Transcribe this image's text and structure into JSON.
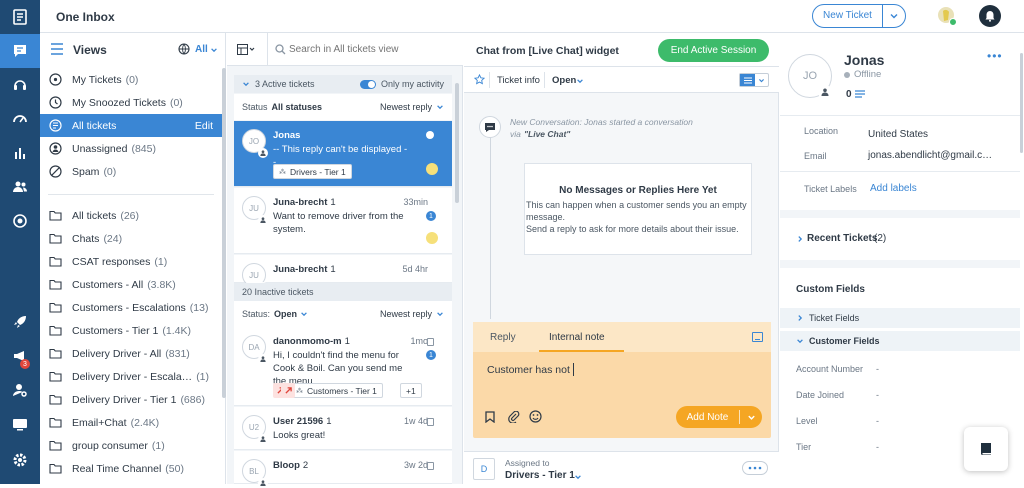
{
  "app": {
    "title": "One Inbox",
    "new_ticket_label": "New Ticket"
  },
  "rail": {
    "items": [
      "articles-icon",
      "inbox-icon",
      "headset-icon",
      "dashboard-icon",
      "reports-icon",
      "contacts-icon",
      "target-icon",
      "rocket-icon",
      "announcements-icon",
      "user-settings-icon",
      "monitor-icon",
      "settings-icon"
    ],
    "announcement_badge": "3"
  },
  "views": {
    "title": "Views",
    "filter_label": "All",
    "edit_label": "Edit",
    "items": [
      {
        "label": "My Tickets",
        "count": "(0)",
        "icon": "my-tickets-icon"
      },
      {
        "label": "My Snoozed Tickets",
        "count": "(0)",
        "icon": "clock-icon"
      },
      {
        "label": "All tickets",
        "count": "",
        "icon": "all-tickets-icon"
      },
      {
        "label": "Unassigned",
        "count": "(845)",
        "icon": "unassigned-icon"
      },
      {
        "label": "Spam",
        "count": "(0)",
        "icon": "spam-icon"
      }
    ],
    "folders": [
      {
        "label": "All tickets",
        "count": "(26)"
      },
      {
        "label": "Chats",
        "count": "(24)"
      },
      {
        "label": "CSAT responses",
        "count": "(1)"
      },
      {
        "label": "Customers - All",
        "count": "(3.8K)"
      },
      {
        "label": "Customers - Escalations",
        "count": "(13)"
      },
      {
        "label": "Customers - Tier 1",
        "count": "(1.4K)"
      },
      {
        "label": "Delivery Driver - All",
        "count": "(831)"
      },
      {
        "label": "Delivery Driver - Escala…",
        "count": "(1)"
      },
      {
        "label": "Delivery Driver - Tier 1",
        "count": "(686)"
      },
      {
        "label": "Email+Chat",
        "count": "(2.4K)"
      },
      {
        "label": "group consumer",
        "count": "(1)"
      },
      {
        "label": "Real Time Channel",
        "count": "(50)"
      }
    ]
  },
  "list": {
    "search_placeholder": "Search in All tickets view",
    "active_header": "3 Active tickets",
    "only_my_activity": "Only my activity",
    "status_label": "Status",
    "status_value": "All statuses",
    "sort_label": "Newest reply",
    "inactive_header": "20 Inactive tickets",
    "status2_label": "Status:",
    "status2_value": "Open",
    "active": [
      {
        "initials": "JO",
        "name": "Jonas",
        "num": "",
        "time": "",
        "snippet": "-- This reply can't be displayed --",
        "tag": "Drivers - Tier 1"
      },
      {
        "initials": "JU",
        "name": "Juna-brecht",
        "num": "1",
        "time": "33min",
        "snippet": "Want to remove driver from the system.",
        "unread": "1"
      },
      {
        "initials": "JU",
        "name": "Juna-brecht",
        "num": "1",
        "time": "5d 4hr",
        "snippet": ""
      }
    ],
    "inactive": [
      {
        "initials": "DA",
        "name": "danonmomo-m",
        "num": "1",
        "time": "1mo",
        "snippet": "Hi, I couldn't find the menu for Cook & Boil. Can you send me the menu…",
        "unread": "1",
        "tag": "Customers - Tier 1",
        "more": "+1"
      },
      {
        "initials": "U2",
        "name": "User 21596",
        "num": "1",
        "time": "1w 4d",
        "snippet": "Looks great!"
      },
      {
        "initials": "BL",
        "name": "Bloop",
        "num": "2",
        "time": "3w 2d",
        "snippet": ""
      }
    ]
  },
  "conversation": {
    "title": "Chat from [Live Chat] widget",
    "end_session": "End Active Session",
    "ticket_info": "Ticket info",
    "status": "Open",
    "event_text": "New Conversation: Jonas started a conversation",
    "event_via": "via",
    "event_channel": "\"Live Chat\"",
    "nomsg_title": "No Messages or Replies Here Yet",
    "nomsg_body1": "This can happen when a customer sends you an empty message.",
    "nomsg_body2": "Send a reply to ask for more details about their issue.",
    "reply_tab": "Reply",
    "note_tab": "Internal note",
    "draft": "Customer has not",
    "add_note": "Add Note",
    "assigned_label": "Assigned to",
    "assigned_value": "Drivers - Tier 1",
    "assigned_initial": "D"
  },
  "contact": {
    "initials": "JO",
    "name": "Jonas",
    "status": "Offline",
    "score": "0",
    "location_label": "Location",
    "location_value": "United States",
    "email_label": "Email",
    "email_value": "jonas.abendlicht@gmail.c…",
    "labels_label": "Ticket Labels",
    "add_labels": "Add labels",
    "recent_tickets": "Recent Tickets",
    "recent_count": "(2)",
    "custom_fields": "Custom Fields",
    "ticket_fields": "Ticket Fields",
    "customer_fields": "Customer Fields",
    "fields": [
      {
        "label": "Account Number",
        "value": "-"
      },
      {
        "label": "Date Joined",
        "value": "-"
      },
      {
        "label": "Level",
        "value": "-"
      },
      {
        "label": "Tier",
        "value": "-"
      }
    ]
  },
  "colors": {
    "primary": "#3a86d4",
    "rail": "#1f4a73",
    "success": "#3dbb6b",
    "note": "#fbd9a8",
    "note_button": "#f5a623"
  }
}
